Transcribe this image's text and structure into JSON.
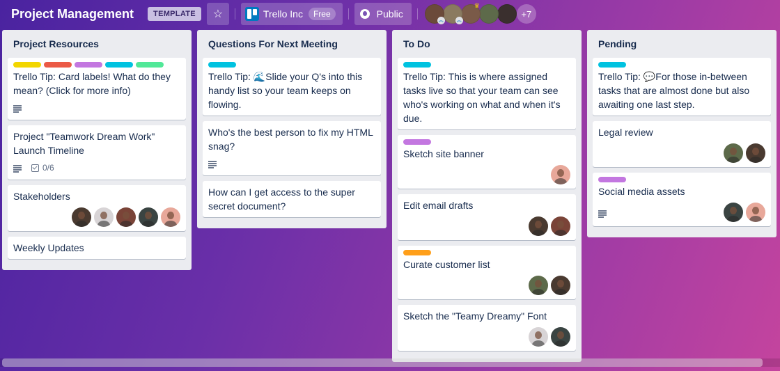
{
  "header": {
    "board_title": "Project Management",
    "template_badge": "TEMPLATE",
    "star_icon": "☆",
    "workspace_name": "Trello Inc",
    "workspace_plan": "Free",
    "visibility": "Public",
    "members": [
      {
        "color": "#6b4a3a",
        "admin": true
      },
      {
        "color": "#8a7a60",
        "admin": true
      },
      {
        "color": "#7a5a48",
        "crown": true
      },
      {
        "color": "#5d6a4a"
      },
      {
        "color": "#3a2f2e"
      }
    ],
    "more_members": "+7"
  },
  "colors": {
    "label_yellow": "#f2d600",
    "label_red": "#eb5a46",
    "label_purple": "#c377e0",
    "label_blue": "#00c2e0",
    "label_green": "#51e898",
    "label_orange": "#ff9f1a"
  },
  "lists": [
    {
      "title": "Project Resources",
      "cards": [
        {
          "labels": [
            "#f2d600",
            "#eb5a46",
            "#c377e0",
            "#00c2e0",
            "#51e898"
          ],
          "text": "Trello Tip: Card labels! What do they mean? (Click for more info)",
          "description": true
        },
        {
          "text": "Project \"Teamwork Dream Work\" Launch Timeline",
          "description": true,
          "checklist": "0/6"
        },
        {
          "text": "Stakeholders",
          "avatars": [
            "#4a3a30",
            "#d8d4d6",
            "#7a4438",
            "#3a4442",
            "#e8a89a"
          ]
        },
        {
          "text": "Weekly Updates"
        }
      ]
    },
    {
      "title": "Questions For Next Meeting",
      "cards": [
        {
          "labels": [
            "#00c2e0"
          ],
          "text_prefix": "Trello Tip: ",
          "emoji": "🌊",
          "text": "Slide your Q's into this handy list so your team keeps on flowing."
        },
        {
          "text": "Who's the best person to fix my HTML snag?",
          "description": true
        },
        {
          "text": "How can I get access to the super secret document?"
        }
      ]
    },
    {
      "title": "To Do",
      "cards": [
        {
          "labels": [
            "#00c2e0"
          ],
          "text": "Trello Tip: This is where assigned tasks live so that your team can see who's working on what and when it's due."
        },
        {
          "labels": [
            "#c377e0"
          ],
          "text": "Sketch site banner",
          "avatars": [
            "#e8a89a"
          ]
        },
        {
          "text": "Edit email drafts",
          "avatars": [
            "#4a3a30",
            "#7a4438"
          ]
        },
        {
          "labels": [
            "#ff9f1a"
          ],
          "text": "Curate customer list",
          "avatars": [
            "#5d6a4a",
            "#4a3a30"
          ]
        },
        {
          "text": "Sketch the \"Teamy Dreamy\" Font",
          "avatars": [
            "#d8d4d6",
            "#3a4442"
          ]
        }
      ]
    },
    {
      "title": "Pending",
      "cards": [
        {
          "labels": [
            "#00c2e0"
          ],
          "text_prefix": "Trello Tip: ",
          "emoji": "💬",
          "text": "For those in-between tasks that are almost done but also awaiting one last step."
        },
        {
          "text": "Legal review",
          "avatars": [
            "#5d6a4a",
            "#4a3a30"
          ]
        },
        {
          "labels": [
            "#c377e0"
          ],
          "text": "Social media assets",
          "description": true,
          "avatars": [
            "#3a4442",
            "#e8a89a"
          ]
        }
      ]
    }
  ],
  "scrollbar": {
    "visible_fraction": 0.975,
    "position": 0
  }
}
